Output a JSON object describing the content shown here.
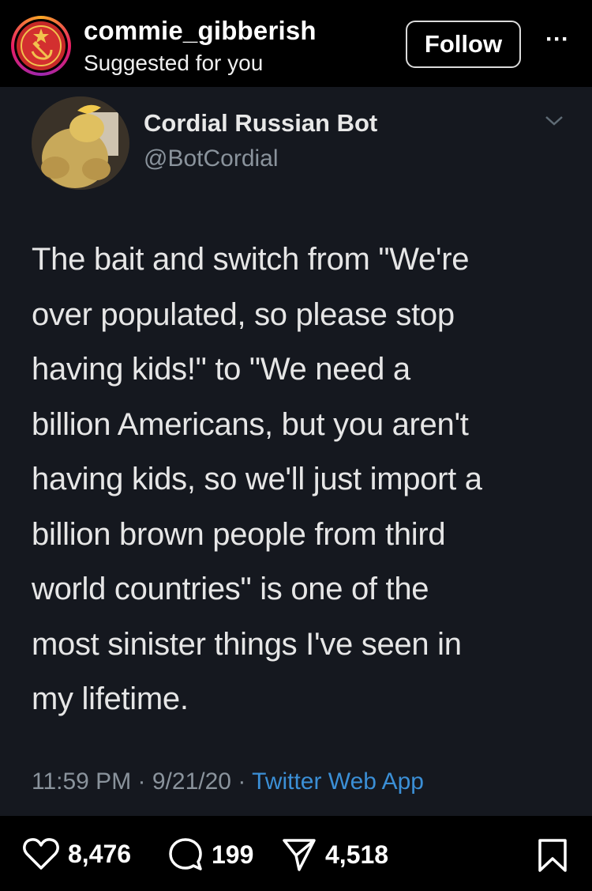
{
  "header": {
    "username": "commie_gibberish",
    "subline": "Suggested for you",
    "follow_label": "Follow",
    "more_label": "···"
  },
  "tweet": {
    "display_name": "Cordial Russian Bot",
    "handle": "@BotCordial",
    "lines": [
      "The bait and switch from \"We're",
      "over populated, so please stop",
      "having kids!\" to \"We need a",
      "billion Americans, but you aren't",
      "having kids, so we'll just import a",
      "billion brown people from third",
      "world countries\" is one of the",
      "most sinister things I've seen in",
      "my lifetime."
    ],
    "time": "11:59 PM",
    "date": "9/21/20",
    "source": "Twitter Web App",
    "sep": "·"
  },
  "actions": {
    "likes": "8,476",
    "comments": "199",
    "shares": "4,518"
  },
  "colors": {
    "background": "#000000",
    "tweet_bg": "#15181f",
    "link_blue": "#3b8fd6",
    "muted": "#8a939c"
  },
  "icons": {
    "like": "heart-icon",
    "comment": "comment-icon",
    "share": "send-icon",
    "save": "bookmark-icon",
    "more": "more-icon",
    "chevron": "chevron-down-icon"
  }
}
